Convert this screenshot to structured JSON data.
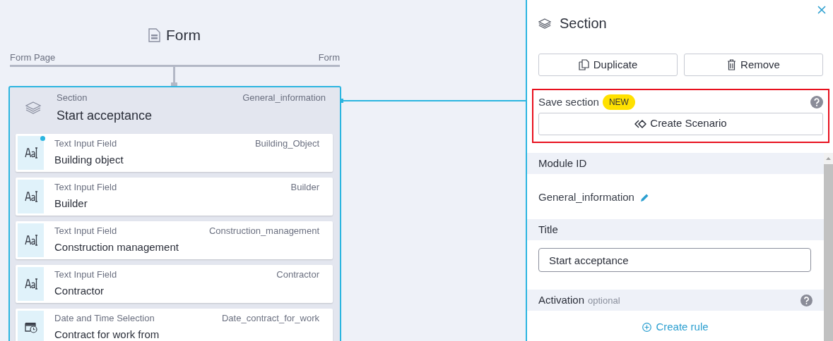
{
  "canvas": {
    "title": "Form",
    "line_left": "Form Page",
    "line_right": "Form",
    "section": {
      "type": "Section",
      "title": "Start acceptance",
      "id": "General_information",
      "fields": [
        {
          "kind": "text",
          "type": "Text Input Field",
          "title": "Building object",
          "id": "Building_Object",
          "dot": true
        },
        {
          "kind": "text",
          "type": "Text Input Field",
          "title": "Builder",
          "id": "Builder",
          "dot": false
        },
        {
          "kind": "text",
          "type": "Text Input Field",
          "title": "Construction management",
          "id": "Construction_management",
          "dot": false
        },
        {
          "kind": "text",
          "type": "Text Input Field",
          "title": "Contractor",
          "id": "Contractor",
          "dot": false
        },
        {
          "kind": "datetime",
          "type": "Date and Time Selection",
          "title": "Contract for work from",
          "id": "Date_contract_for_work",
          "dot": false
        }
      ]
    }
  },
  "panel": {
    "title": "Section",
    "buttons": [
      "Duplicate",
      "Remove"
    ],
    "save": {
      "label": "Save section",
      "badge": "NEW",
      "button": "Create Scenario"
    },
    "module_id": {
      "heading": "Module ID",
      "value": "General_information"
    },
    "title_field": {
      "heading": "Title",
      "value": "Start acceptance"
    },
    "activation": {
      "heading": "Activation",
      "note": "optional",
      "link": "Create rule"
    }
  }
}
